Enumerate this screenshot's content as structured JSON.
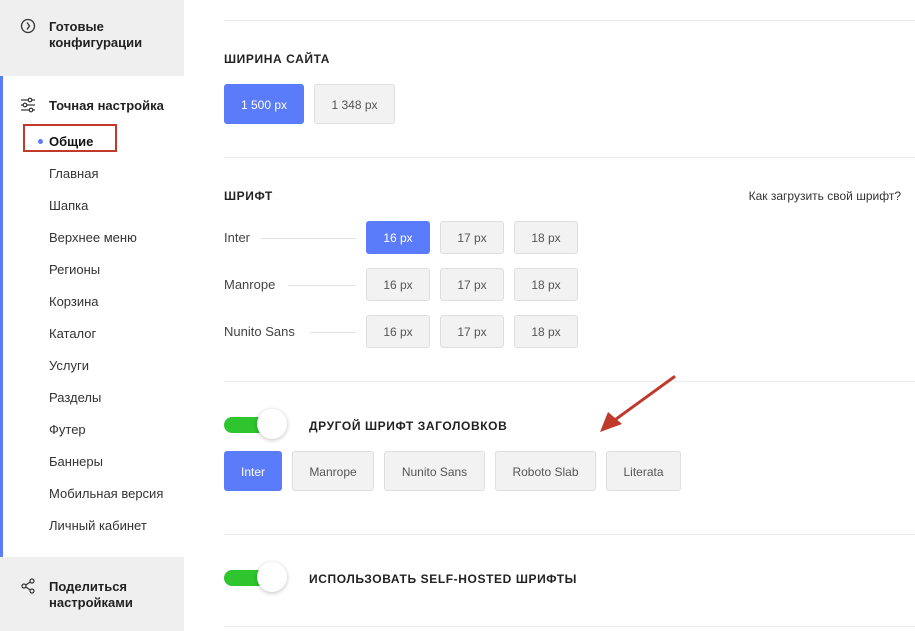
{
  "sidebar": {
    "presets_label": "Готовые конфигурации",
    "fine_tune_label": "Точная настройка",
    "items": [
      {
        "label": "Общие"
      },
      {
        "label": "Главная"
      },
      {
        "label": "Шапка"
      },
      {
        "label": "Верхнее меню"
      },
      {
        "label": "Регионы"
      },
      {
        "label": "Корзина"
      },
      {
        "label": "Каталог"
      },
      {
        "label": "Услуги"
      },
      {
        "label": "Разделы"
      },
      {
        "label": "Футер"
      },
      {
        "label": "Баннеры"
      },
      {
        "label": "Мобильная версия"
      },
      {
        "label": "Личный кабинет"
      }
    ],
    "active_item": "Общие",
    "share_label": "Поделиться настройками"
  },
  "site_width": {
    "title": "ШИРИНА САЙТА",
    "options": [
      "1 500 px",
      "1 348 px"
    ],
    "selected": "1 500 px"
  },
  "font": {
    "title": "ШРИФТ",
    "help_link": "Как загрузить свой шрифт?",
    "rows": [
      {
        "name": "Inter",
        "sizes": [
          "16 px",
          "17 px",
          "18 px"
        ],
        "selected": "16 px"
      },
      {
        "name": "Manrope",
        "sizes": [
          "16 px",
          "17 px",
          "18 px"
        ]
      },
      {
        "name": "Nunito Sans",
        "sizes": [
          "16 px",
          "17 px",
          "18 px"
        ]
      }
    ]
  },
  "heading_font": {
    "enabled": true,
    "title": "ДРУГОЙ ШРИФТ ЗАГОЛОВКОВ",
    "options": [
      "Inter",
      "Manrope",
      "Nunito Sans",
      "Roboto Slab",
      "Literata"
    ],
    "selected": "Inter"
  },
  "self_hosted": {
    "enabled": true,
    "title": "ИСПОЛЬЗОВАТЬ SELF-HOSTED ШРИФТЫ"
  },
  "colors": {
    "accent": "#5b7cfa",
    "toggle_on": "#2ec52e",
    "highlight": "#c0392b"
  }
}
